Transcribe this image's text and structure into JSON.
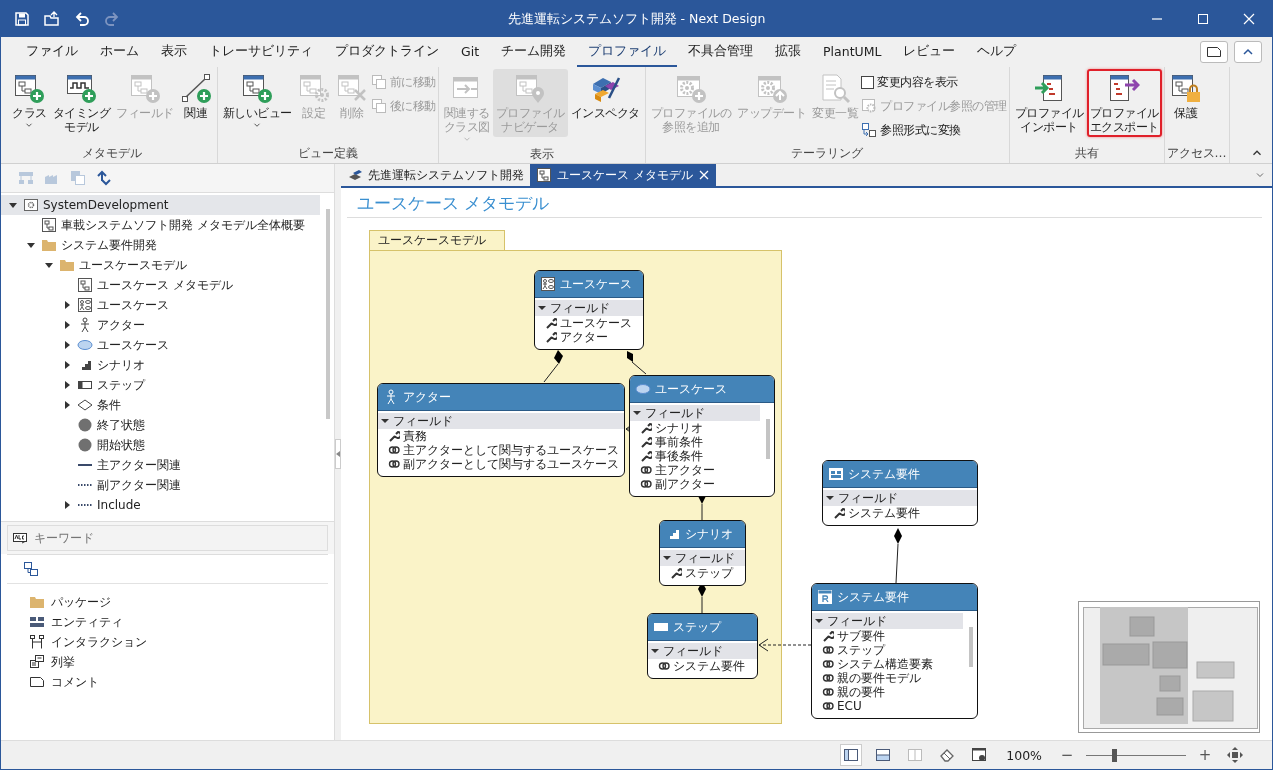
{
  "window": {
    "title": "先進運転システムソフト開発 - Next Design"
  },
  "quick_access": [
    {
      "disabled": false
    },
    {
      "disabled": false
    },
    {
      "disabled": false
    },
    {
      "disabled": true
    }
  ],
  "ribbon_tabs": [
    {
      "label": "ファイル",
      "selected": false
    },
    {
      "label": "ホーム",
      "selected": false
    },
    {
      "label": "表示",
      "selected": false
    },
    {
      "label": "トレーサビリティ",
      "selected": false
    },
    {
      "label": "プロダクトライン",
      "selected": false
    },
    {
      "label": "Git",
      "selected": false
    },
    {
      "label": "チーム開発",
      "selected": false
    },
    {
      "label": "プロファイル",
      "selected": true
    },
    {
      "label": "不具合管理",
      "selected": false
    },
    {
      "label": "拡張",
      "selected": false
    },
    {
      "label": "PlantUML",
      "selected": false
    },
    {
      "label": "レビュー",
      "selected": false
    },
    {
      "label": "ヘルプ",
      "selected": false
    }
  ],
  "ribbon_groups": [
    {
      "label": "メタモデル",
      "items": [
        {
          "kind": "large",
          "label": [
            "クラス"
          ],
          "disabled": false,
          "dropdown": true
        },
        {
          "kind": "large",
          "label": [
            "タイミング",
            "モデル"
          ],
          "disabled": false
        },
        {
          "kind": "large",
          "label": [
            "フィールド"
          ],
          "disabled": true
        },
        {
          "kind": "large",
          "label": [
            "関連"
          ],
          "disabled": false
        }
      ]
    },
    {
      "label": "ビュー定義",
      "items": [
        {
          "kind": "large",
          "label": [
            "新しいビュー"
          ],
          "disabled": false,
          "dropdown": true
        },
        {
          "kind": "large",
          "label": [
            "設定"
          ],
          "disabled": true
        },
        {
          "kind": "large",
          "label": [
            "削除"
          ],
          "disabled": true
        },
        {
          "kind": "stack",
          "items": [
            {
              "kind": "small",
              "label": "前に移動",
              "disabled": true
            },
            {
              "kind": "small",
              "label": "後に移動",
              "disabled": true
            }
          ]
        }
      ]
    },
    {
      "label": "表示",
      "items": [
        {
          "kind": "large",
          "label": [
            "関連する",
            "クラス図"
          ],
          "disabled": true,
          "dropdown": true
        },
        {
          "kind": "large",
          "label": [
            "プロファイル",
            "ナビゲータ"
          ],
          "disabled": true,
          "pressed": true
        },
        {
          "kind": "large",
          "label": [
            "インスペクタ"
          ],
          "disabled": false
        }
      ]
    },
    {
      "label": "テーラリング",
      "items": [
        {
          "kind": "large",
          "label": [
            "プロファイルの",
            "参照を追加"
          ],
          "disabled": true
        },
        {
          "kind": "large",
          "label": [
            "アップデート"
          ],
          "disabled": true
        },
        {
          "kind": "large",
          "label": [
            "変更一覧"
          ],
          "disabled": true
        },
        {
          "kind": "stack",
          "items": [
            {
              "kind": "check",
              "label": "変更内容を表示",
              "checked": false
            },
            {
              "kind": "small",
              "label": "プロファイル参照の管理",
              "disabled": true
            },
            {
              "kind": "small",
              "label": "参照形式に変換",
              "disabled": false
            }
          ]
        }
      ]
    },
    {
      "label": "共有",
      "items": [
        {
          "kind": "large",
          "label": [
            "プロファイル",
            "インポート"
          ],
          "disabled": false
        },
        {
          "kind": "large",
          "label": [
            "プロファイル",
            "エクスポート"
          ],
          "disabled": false,
          "highlighted": true
        }
      ]
    },
    {
      "label": "アクセス…",
      "items": [
        {
          "kind": "large",
          "label": [
            "保護"
          ],
          "disabled": false
        }
      ]
    }
  ],
  "left_toolbar": [
    {
      "disabled": true
    },
    {
      "disabled": true
    },
    {
      "disabled": true
    },
    {
      "disabled": false
    }
  ],
  "tree": [
    {
      "label": "SystemDevelopment",
      "kind": "model",
      "selected": true,
      "expanded": true,
      "children": [
        {
          "label": "車載システムソフト開発 メタモデル全体概要",
          "kind": "diagram",
          "selected": false
        },
        {
          "label": "システム要件開発",
          "kind": "folder",
          "selected": false,
          "expanded": true,
          "children": [
            {
              "label": "ユースケースモデル",
              "kind": "folder",
              "selected": false,
              "expanded": true,
              "children": [
                {
                  "label": "ユースケース メタモデル",
                  "kind": "diagram",
                  "selected": false
                },
                {
                  "label": "ユースケース",
                  "kind": "usecase-class",
                  "selected": false,
                  "expanded": false
                },
                {
                  "label": "アクター",
                  "kind": "actor",
                  "selected": false,
                  "expanded": false
                },
                {
                  "label": "ユースケース",
                  "kind": "ellipse",
                  "selected": false,
                  "expanded": false
                },
                {
                  "label": "シナリオ",
                  "kind": "scenario",
                  "selected": false,
                  "expanded": false
                },
                {
                  "label": "ステップ",
                  "kind": "step",
                  "selected": false,
                  "expanded": false
                },
                {
                  "label": "条件",
                  "kind": "condition",
                  "selected": false,
                  "expanded": false
                },
                {
                  "label": "終了状態",
                  "kind": "state",
                  "selected": false
                },
                {
                  "label": "開始状態",
                  "kind": "state",
                  "selected": false
                },
                {
                  "label": "主アクター関連",
                  "kind": "line",
                  "selected": false
                },
                {
                  "label": "副アクター関連",
                  "kind": "dotted",
                  "selected": false
                },
                {
                  "label": "Include",
                  "kind": "dotted",
                  "selected": false,
                  "expanded": false
                }
              ]
            }
          ]
        }
      ]
    }
  ],
  "search": {
    "placeholder": "キーワード"
  },
  "palette": [
    {
      "label": "パッケージ",
      "kind": "package"
    },
    {
      "label": "エンティティ",
      "kind": "entity"
    },
    {
      "label": "インタラクション",
      "kind": "interaction"
    },
    {
      "label": "列挙",
      "kind": "enumeration"
    },
    {
      "label": "コメント",
      "kind": "comment"
    }
  ],
  "document_tabs": [
    {
      "label": "先進運転システムソフト開発",
      "selected": false
    },
    {
      "label": "ユースケース メタモデル",
      "selected": true
    }
  ],
  "diagram": {
    "title": "ユースケース メタモデル",
    "package": "ユースケースモデル",
    "nodes": [
      {
        "title": "ユースケース",
        "kind": "usecase-class",
        "section": "フィールド",
        "scrollbar": false,
        "fields": [
          {
            "label": "ユースケース",
            "kind": "attribute"
          },
          {
            "label": "アクター",
            "kind": "attribute"
          }
        ]
      },
      {
        "title": "アクター",
        "kind": "actor",
        "section": "フィールド",
        "scrollbar": false,
        "fields": [
          {
            "label": "責務",
            "kind": "attribute"
          },
          {
            "label": "主アクターとして関与するユースケース",
            "kind": "reference"
          },
          {
            "label": "副アクターとして関与するユースケース",
            "kind": "reference"
          }
        ]
      },
      {
        "title": "ユースケース",
        "kind": "ellipse",
        "section": "フィールド",
        "scrollbar": true,
        "fields": [
          {
            "label": "シナリオ",
            "kind": "attribute"
          },
          {
            "label": "事前条件",
            "kind": "attribute"
          },
          {
            "label": "事後条件",
            "kind": "attribute"
          },
          {
            "label": "主アクター",
            "kind": "reference"
          },
          {
            "label": "副アクター",
            "kind": "reference"
          }
        ]
      },
      {
        "title": "シナリオ",
        "kind": "scenario",
        "section": "フィールド",
        "scrollbar": false,
        "fields": [
          {
            "label": "ステップ",
            "kind": "attribute"
          }
        ]
      },
      {
        "title": "ステップ",
        "kind": "step",
        "section": "フィールド",
        "scrollbar": false,
        "fields": [
          {
            "label": "システム要件",
            "kind": "reference"
          }
        ]
      },
      {
        "title": "システム要件",
        "kind": "requirement-group",
        "section": "フィールド",
        "scrollbar": false,
        "fields": [
          {
            "label": "システム要件",
            "kind": "attribute"
          }
        ]
      },
      {
        "title": "システム要件",
        "kind": "requirement",
        "section": "フィールド",
        "scrollbar": true,
        "fields": [
          {
            "label": "サブ要件",
            "kind": "attribute"
          },
          {
            "label": "ステップ",
            "kind": "reference"
          },
          {
            "label": "システム構造要素",
            "kind": "reference"
          },
          {
            "label": "親の要件モデル",
            "kind": "reference"
          },
          {
            "label": "親の要件",
            "kind": "reference"
          },
          {
            "label": "ECU",
            "kind": "reference"
          }
        ]
      }
    ]
  },
  "status_bar": {
    "layouts": [
      {
        "selected": true
      },
      {
        "selected": false
      },
      {
        "selected": false
      }
    ],
    "zoom": "100%",
    "zoom_out": "−",
    "zoom_in": "+",
    "zoom_slider": {
      "level": 0.28
    }
  }
}
